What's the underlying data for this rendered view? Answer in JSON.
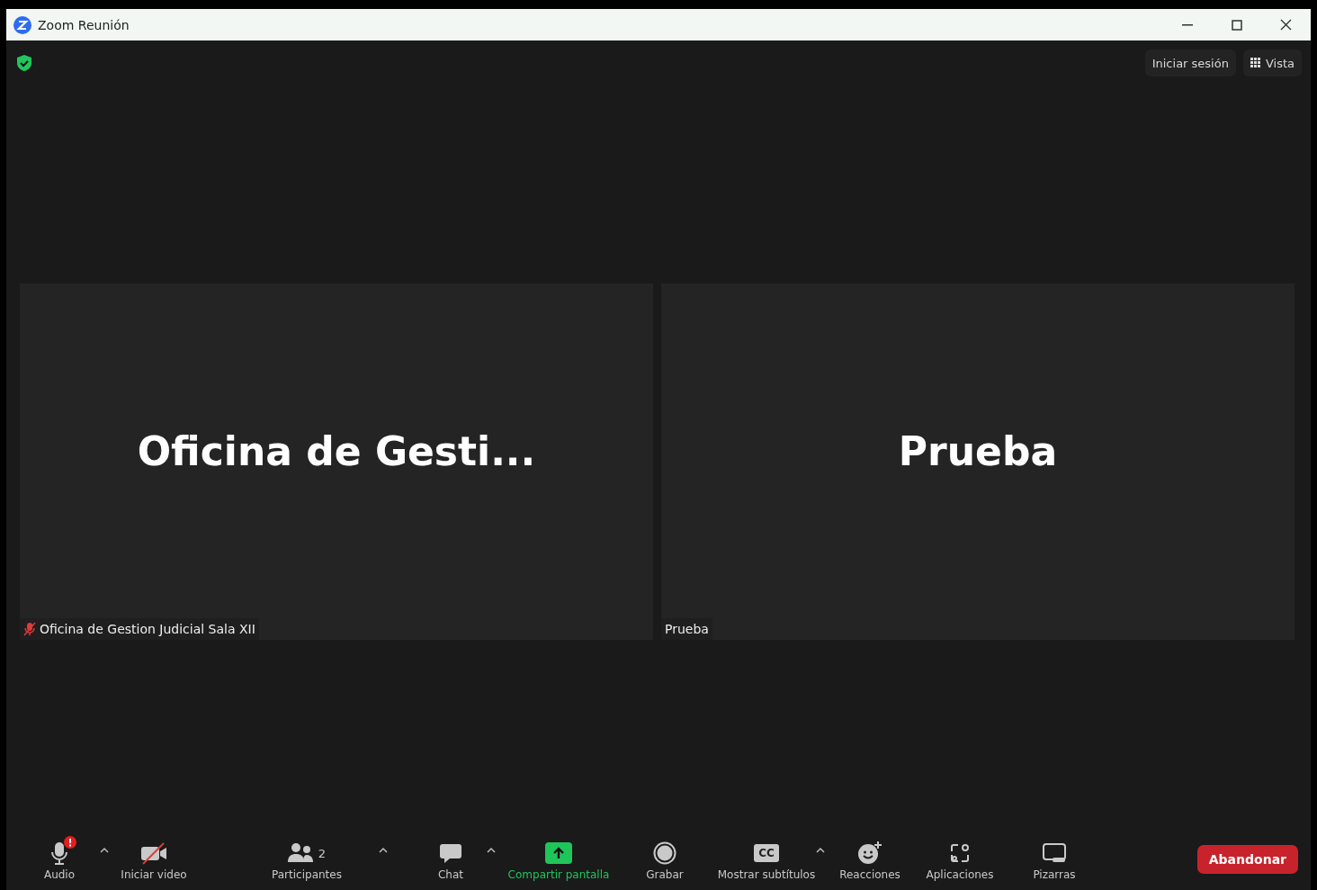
{
  "window": {
    "title": "Zoom Reunión"
  },
  "top_bar": {
    "secure": true,
    "buttons": [
      {
        "kind": "text",
        "label": "Iniciar sesión"
      },
      {
        "kind": "grid",
        "label": "Vista"
      }
    ]
  },
  "tiles": [
    {
      "display_name": "Oficina de Gesti...",
      "label": "Oficina de Gestion Judicial Sala XII",
      "muted": true
    },
    {
      "display_name": "Prueba",
      "label": "Prueba",
      "muted": false
    }
  ],
  "toolbar": {
    "items": [
      {
        "kind": "mic",
        "label": "Audio",
        "alert": true,
        "caret": true,
        "highlighted": false
      },
      {
        "kind": "video",
        "label": "Iniciar video",
        "caret": false,
        "highlighted": false
      },
      {
        "kind": "people",
        "label": "Participantes",
        "count": "2",
        "caret": true,
        "highlighted": false
      },
      {
        "kind": "chat",
        "label": "Chat",
        "caret": true,
        "highlighted": false
      },
      {
        "kind": "share",
        "label": "Compartir pantalla",
        "caret": false,
        "highlighted": true
      },
      {
        "kind": "record",
        "label": "Grabar",
        "caret": false,
        "highlighted": false
      },
      {
        "kind": "cc",
        "label": "Mostrar subtítulos",
        "icon_text": "CC",
        "caret": true,
        "highlighted": false
      },
      {
        "kind": "reactions",
        "label": "Reacciones",
        "caret": false,
        "highlighted": false
      },
      {
        "kind": "apps",
        "label": "Aplicaciones",
        "caret": false,
        "highlighted": false
      },
      {
        "kind": "whiteboard",
        "label": "Pizarras",
        "caret": false,
        "highlighted": false
      }
    ],
    "leave": "Abandonar"
  }
}
